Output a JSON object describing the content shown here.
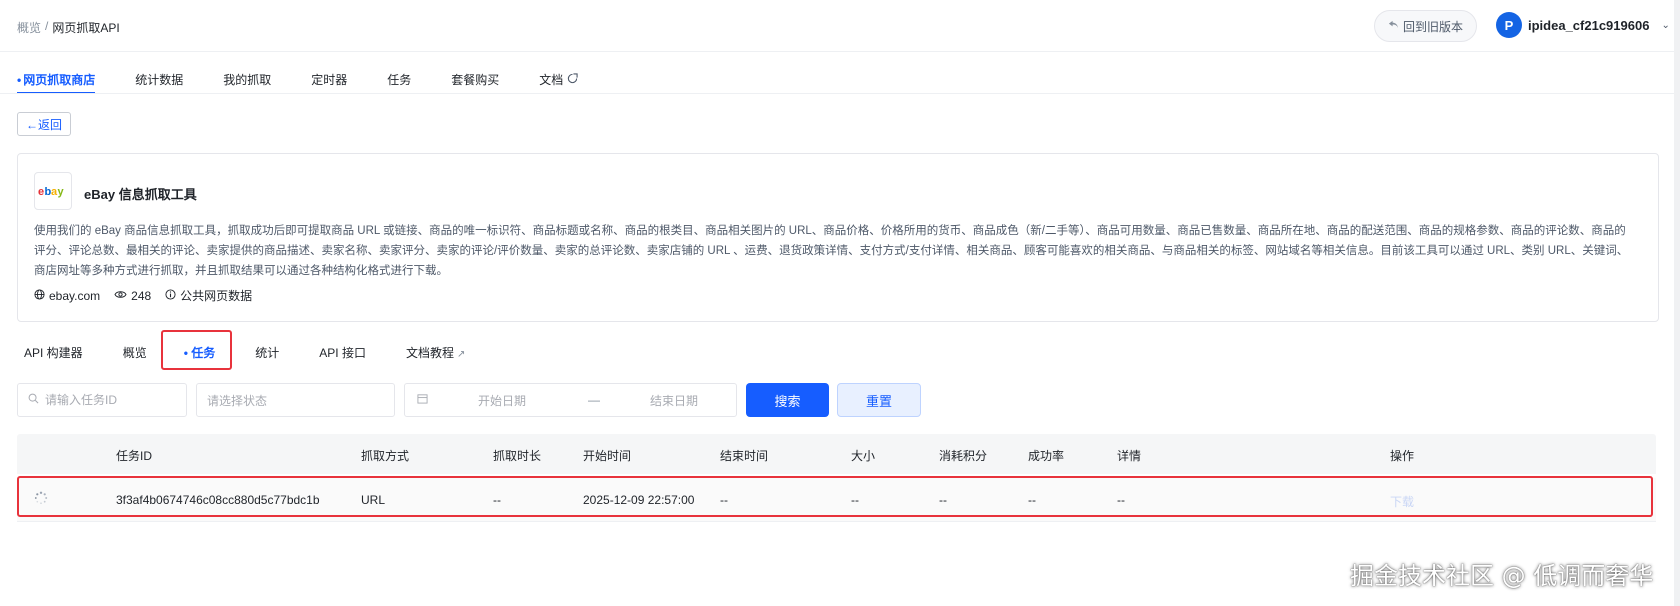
{
  "header": {
    "breadcrumb_prev": "概览",
    "breadcrumb_sep": "/",
    "breadcrumb_current": "网页抓取API",
    "old_version_label": "回到旧版本",
    "username": "ipidea_cf21c919606",
    "avatar_letter": "P"
  },
  "nav": {
    "items": [
      {
        "label": "网页抓取商店",
        "active": true
      },
      {
        "label": "统计数据"
      },
      {
        "label": "我的抓取"
      },
      {
        "label": "定时器"
      },
      {
        "label": "任务"
      },
      {
        "label": "套餐购买"
      },
      {
        "label": "文档"
      }
    ]
  },
  "back_label": "←返回",
  "product": {
    "title": "eBay 信息抓取工具",
    "description": "使用我们的 eBay 商品信息抓取工具，抓取成功后即可提取商品 URL 或链接、商品的唯一标识符、商品标题或名称、商品的根类目、商品相关图片的 URL、商品价格、价格所用的货币、商品成色（新/二手等）、商品可用数量、商品已售数量、商品所在地、商品的配送范围、商品的规格参数、商品的评论数、商品的评分、评论总数、最相关的评论、卖家提供的商品描述、卖家名称、卖家评分、卖家的评论/评价数量、卖家的总评论数、卖家店铺的 URL 、运费、退货政策详情、支付方式/支付详情、相关商品、顾客可能喜欢的相关商品、与商品相关的标签、网站域名等相关信息。目前该工具可以通过 URL、类别 URL、关键词、商店网址等多种方式进行抓取，并且抓取结果可以通过各种结构化格式进行下载。",
    "domain": "ebay.com",
    "views": "248",
    "data_type": "公共网页数据"
  },
  "subtabs": [
    {
      "label": "API 构建器"
    },
    {
      "label": "概览"
    },
    {
      "label": "任务",
      "active": true
    },
    {
      "label": "统计"
    },
    {
      "label": "API 接口"
    },
    {
      "label": "文档教程"
    }
  ],
  "filters": {
    "task_id_placeholder": "请输入任务ID",
    "status_placeholder": "请选择状态",
    "start_date_placeholder": "开始日期",
    "date_sep": "—",
    "end_date_placeholder": "结束日期",
    "search_label": "搜索",
    "reset_label": "重置"
  },
  "table": {
    "columns": [
      "任务ID",
      "抓取方式",
      "抓取时长",
      "开始时间",
      "结束时间",
      "大小",
      "消耗积分",
      "成功率",
      "详情",
      "操作"
    ],
    "rows": [
      {
        "task_id": "3f3af4b0674746c08cc880d5c77bdc1b",
        "method": "URL",
        "duration": "--",
        "start_time": "2025-12-09 22:57:00",
        "end_time": "--",
        "size": "--",
        "points": "--",
        "success_rate": "--",
        "details": "--",
        "action": "下载"
      }
    ]
  },
  "watermark": "掘金技术社区 @ 低调而奢华"
}
